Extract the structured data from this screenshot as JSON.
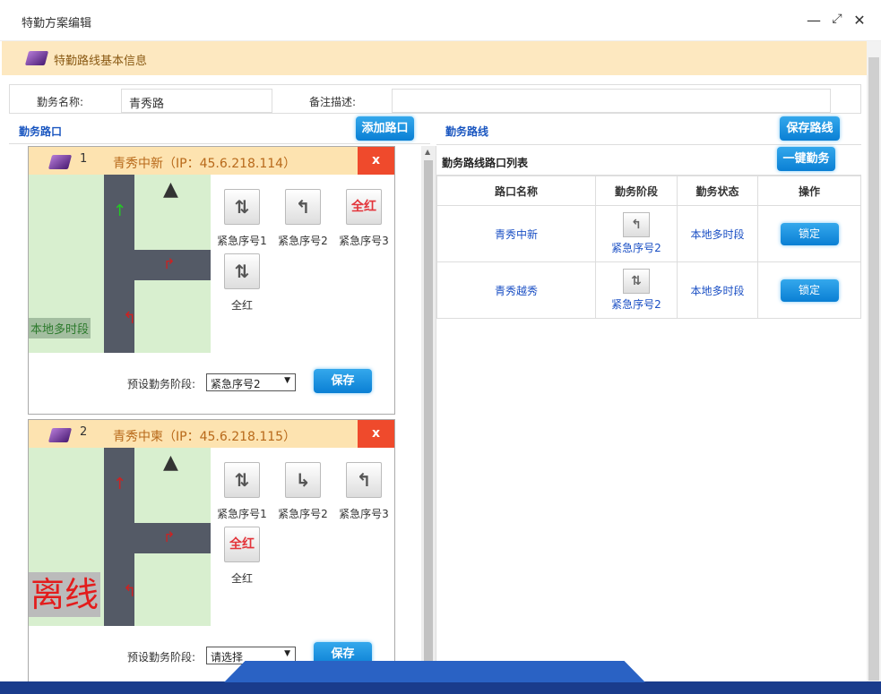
{
  "window": {
    "title": "特勤方案编辑",
    "min": "—",
    "max": "⤢",
    "close": "✕"
  },
  "section": {
    "title": "特勤路线基本信息"
  },
  "form": {
    "name_label": "勤务名称:",
    "name_value": "青秀路",
    "remark_label": "备注描述:",
    "remark_value": ""
  },
  "left": {
    "title": "勤务路口",
    "add_btn": "添加路口"
  },
  "right": {
    "title": "勤务路线",
    "save_btn": "保存路线",
    "list_title": "勤务路线路口列表",
    "one_key_btn": "一键勤务"
  },
  "cards": [
    {
      "num": "1",
      "name": "青秀中新（IP：45.6.218.114）",
      "close": "x",
      "map_label": "本地多时段",
      "phases": [
        {
          "icon": "⇅",
          "label": "紧急序号1"
        },
        {
          "icon": "↰",
          "label": "紧急序号2"
        },
        {
          "icon": "全红",
          "label": "紧急序号3"
        },
        {
          "icon": "⇅",
          "label": "全红"
        }
      ],
      "preset_label": "预设勤务阶段:",
      "preset_value": "紧急序号2",
      "save": "保存"
    },
    {
      "num": "2",
      "name": "青秀中柬（IP：45.6.218.115）",
      "close": "x",
      "map_label": "离线",
      "phases": [
        {
          "icon": "⇅",
          "label": "紧急序号1"
        },
        {
          "icon": "↳",
          "label": "紧急序号2"
        },
        {
          "icon": "↰",
          "label": "紧急序号3"
        },
        {
          "icon": "全红",
          "label": "全红"
        }
      ],
      "preset_label": "预设勤务阶段:",
      "preset_value": "请选择",
      "save": "保存"
    }
  ],
  "table": {
    "headers": [
      "路口名称",
      "勤务阶段",
      "勤务状态",
      "操作"
    ],
    "rows": [
      {
        "name": "青秀中新",
        "phase_icon": "↰",
        "phase": "紧急序号2",
        "status": "本地多时段",
        "action": "锁定"
      },
      {
        "name": "青秀越秀",
        "phase_icon": "⇅",
        "phase": "紧急序号2",
        "status": "本地多时段",
        "action": "锁定"
      }
    ]
  },
  "colors": {
    "accent": "#0a7fd4",
    "header_bg": "#fde8c0",
    "close_red": "#ef4a2c"
  }
}
